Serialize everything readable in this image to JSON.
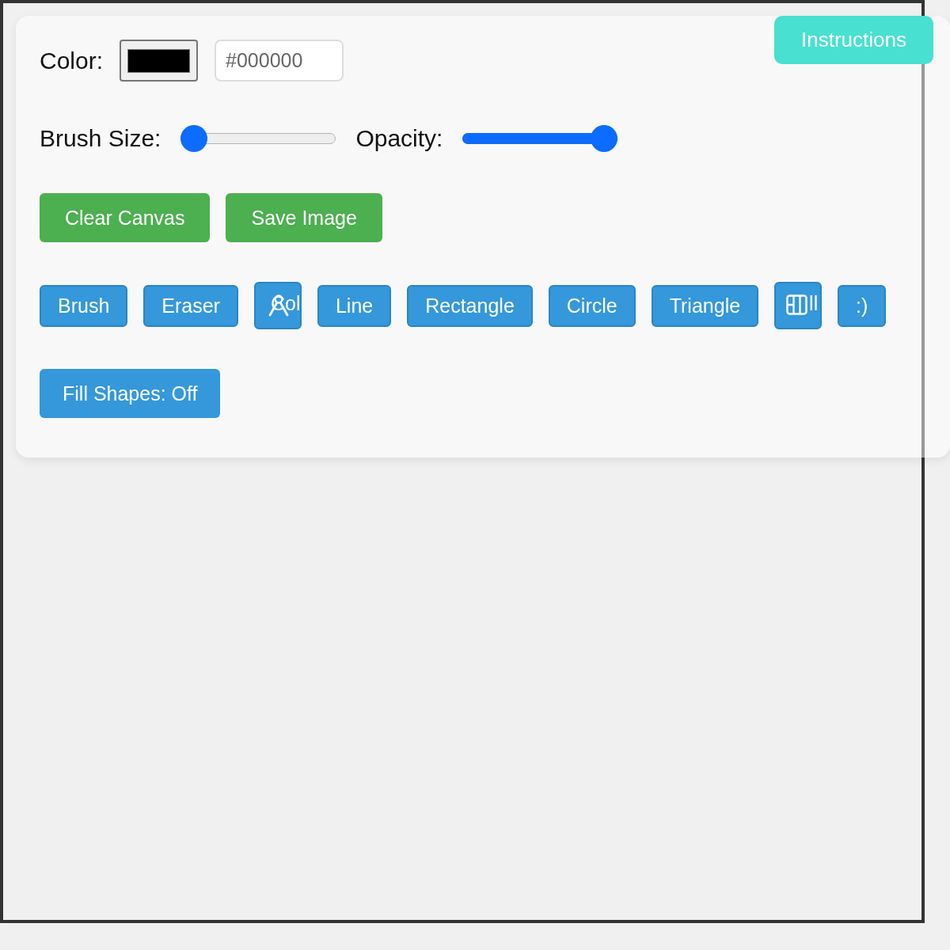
{
  "instructions_button": {
    "label": "Instructions"
  },
  "color_row": {
    "label": "Color:",
    "hex_value": "#000000"
  },
  "sliders": [
    {
      "label": "Brush Size:",
      "level": 0
    },
    {
      "label": "Opacity:",
      "level": 1
    }
  ],
  "action_buttons": [
    {
      "label": "Clear Canvas"
    },
    {
      "label": "Save Image"
    }
  ],
  "tool_buttons": [
    {
      "kind": "plain",
      "label": "Brush"
    },
    {
      "kind": "plain",
      "label": "Eraser"
    },
    {
      "kind": "picker",
      "label": "Col"
    },
    {
      "kind": "plain",
      "label": "Line"
    },
    {
      "kind": "plain",
      "label": "Rectangle"
    },
    {
      "kind": "plain",
      "label": "Circle"
    },
    {
      "kind": "plain",
      "label": "Triangle"
    },
    {
      "kind": "bucket",
      "label": "ll"
    },
    {
      "kind": "plain",
      "label": ":)"
    }
  ],
  "fill_toggle": {
    "label": "Fill Shapes: Off"
  }
}
